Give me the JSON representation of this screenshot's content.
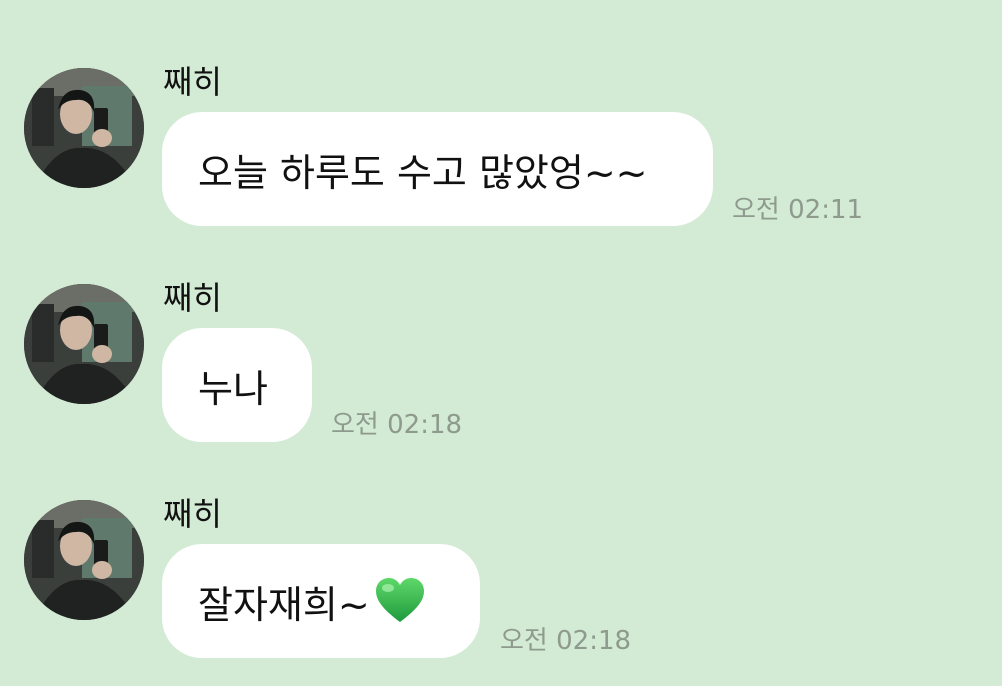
{
  "colors": {
    "background": "#d3ebd4",
    "bubble": "#ffffff",
    "timestamp": "#8d9a8d",
    "heart": "#2bb24c"
  },
  "messages": [
    {
      "sender": "째히",
      "text": "오늘 하루도 수고 많았엉~~",
      "time": "오전 02:11",
      "avatar_icon": "profile-photo"
    },
    {
      "sender": "째히",
      "text": "누나",
      "time": "오전 02:18",
      "avatar_icon": "profile-photo"
    },
    {
      "sender": "째히",
      "text": "잘자재희~",
      "emoji": "green-heart-icon",
      "time": "오전 02:18",
      "avatar_icon": "profile-photo"
    }
  ]
}
